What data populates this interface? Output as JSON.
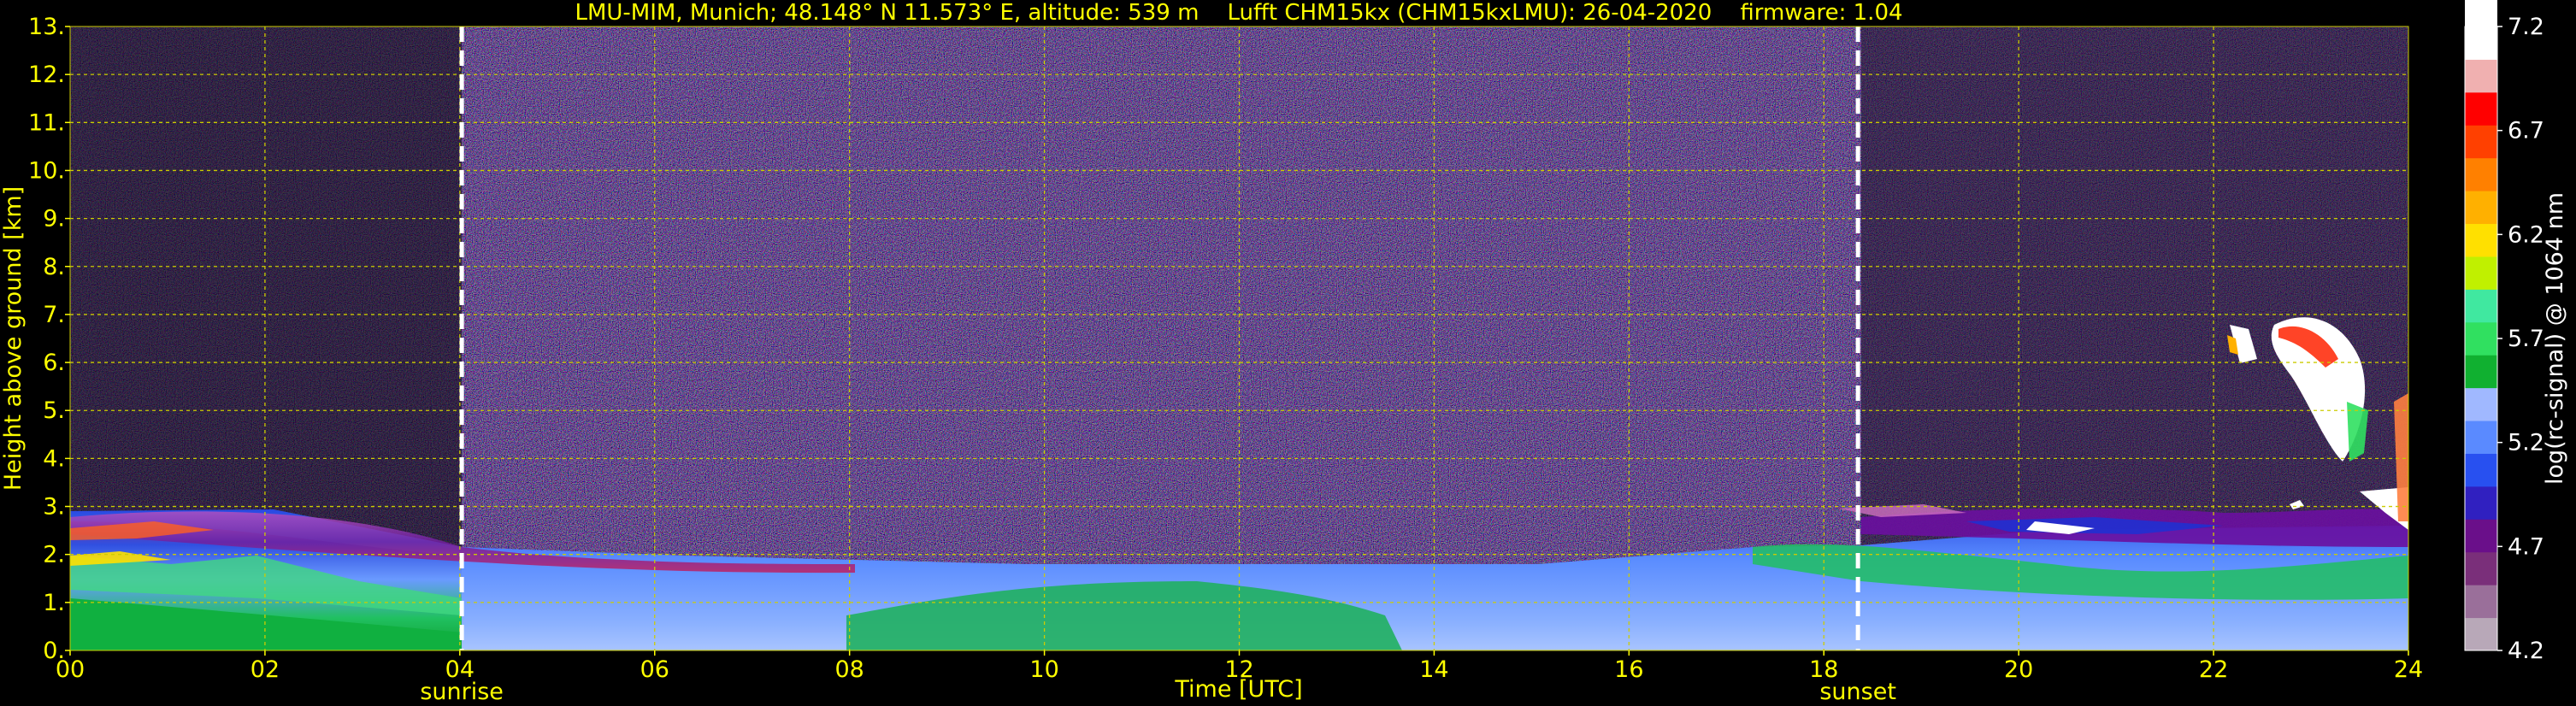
{
  "chart_data": {
    "type": "heatmap",
    "title": "LMU-MIM, Munich; 48.148° N 11.573° E, altitude: 539 m    Lufft CHM15kx (CHM15kxLMU): 26-04-2020    firmware: 1.04",
    "xlabel": "Time [UTC]",
    "ylabel": "Height above ground [km]",
    "colorbar_label": "log(rc-signal) @ 1064 nm",
    "xlim": [
      0,
      24
    ],
    "ylim": [
      0,
      13
    ],
    "x_ticks": [
      "00",
      "02",
      "04",
      "06",
      "08",
      "10",
      "12",
      "14",
      "16",
      "18",
      "20",
      "22",
      "24"
    ],
    "y_ticks": [
      "0.",
      "1.",
      "2.",
      "3.",
      "4.",
      "5.",
      "6.",
      "7.",
      "8.",
      "9.",
      "10.",
      "11.",
      "12.",
      "13."
    ],
    "colorbar_range": [
      4.2,
      7.2
    ],
    "colorbar_ticks": [
      "4.2",
      "4.7",
      "5.2",
      "5.7",
      "6.2",
      "6.7",
      "7.2"
    ],
    "grid": true,
    "markers": [
      {
        "label": "sunrise",
        "x": 4.02
      },
      {
        "label": "sunset",
        "x": 18.35
      }
    ],
    "colors": {
      "text": "#ffff00",
      "grid": "#cccc00",
      "background": "#000000",
      "colormap": [
        "#b8a8b8",
        "#9a6f9a",
        "#7a2f7a",
        "#6a0f8a",
        "#3020c0",
        "#2850f0",
        "#5a8aff",
        "#a0b8ff",
        "#10b030",
        "#30e060",
        "#40e8a0",
        "#c0f000",
        "#ffe000",
        "#ffb000",
        "#ff8000",
        "#ff4000",
        "#ff0000",
        "#f0b0b0",
        "#ffffff"
      ]
    }
  }
}
